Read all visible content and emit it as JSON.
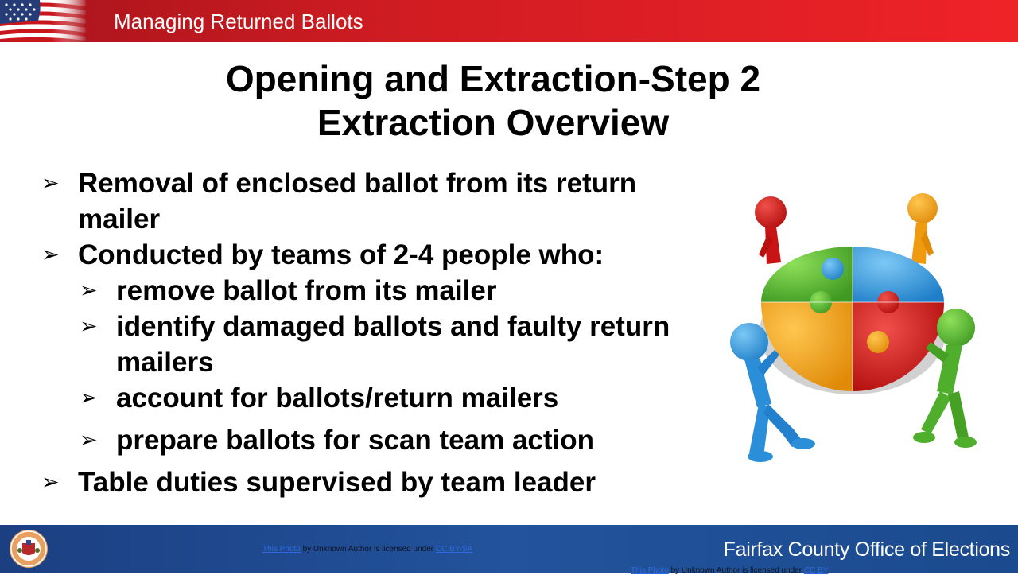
{
  "header": {
    "title": "Managing Returned Ballots"
  },
  "slide": {
    "title_line1": "Opening and Extraction-Step 2",
    "title_line2": "Extraction Overview"
  },
  "bullets": [
    {
      "text": "Removal of enclosed ballot from its return mailer",
      "level": 1
    },
    {
      "text": "Conducted by teams of 2-4 people who:",
      "level": 1
    },
    {
      "text": "remove ballot from its mailer",
      "level": 2
    },
    {
      "text": "identify damaged ballots and faulty return mailers",
      "level": 2
    },
    {
      "text": "account for ballots/return mailers",
      "level": 2
    },
    {
      "text": "prepare ballots for scan team action",
      "level": 2
    },
    {
      "text": "Table duties supervised by team leader",
      "level": 1
    }
  ],
  "bullet_marker": "➢",
  "footer": {
    "organization": "Fairfax County Office of Elections",
    "attribution": {
      "link": "This Photo",
      "middle": " by Unknown Author is licensed under ",
      "license": "CC BY-SA"
    },
    "attribution2": {
      "link": "This Photo",
      "middle": " by Unknown Author is licensed under ",
      "license": "CC BY"
    }
  },
  "colors": {
    "header_red": "#d01c22",
    "footer_blue": "#1f4a92",
    "puzzle_green": "#5db33a",
    "puzzle_blue": "#2f9be0",
    "puzzle_orange": "#f3a012",
    "puzzle_red": "#cc1414"
  },
  "icons": [
    "us-flag-icon",
    "county-seal-icon",
    "puzzle-team-illustration"
  ]
}
